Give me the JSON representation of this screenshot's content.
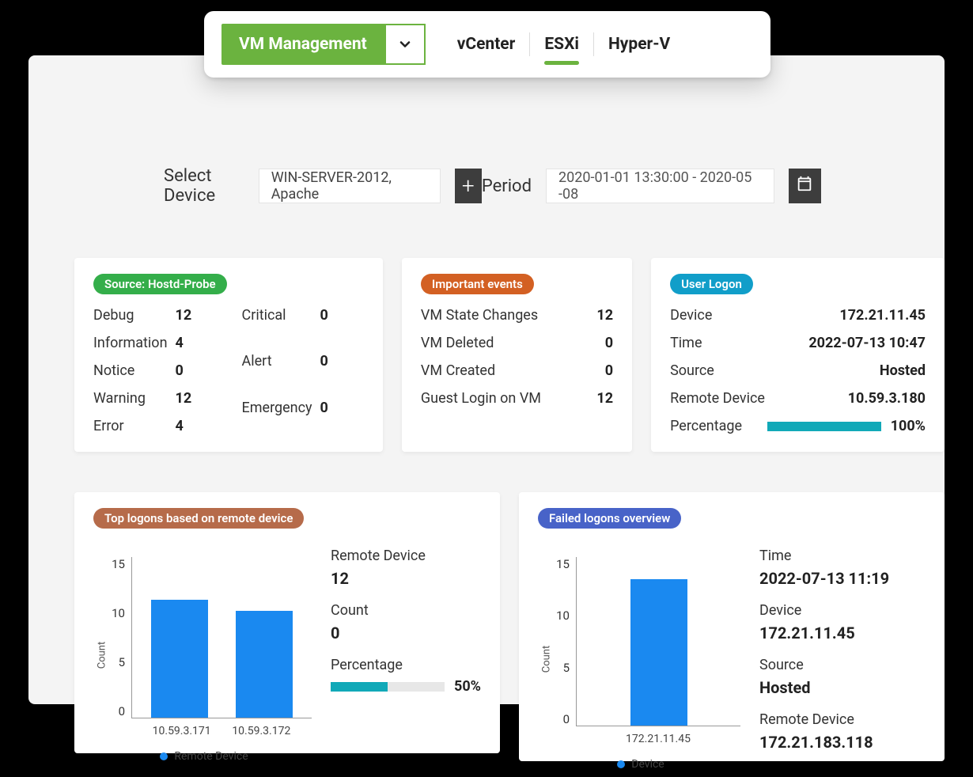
{
  "nav": {
    "dropdown_label": "VM Management",
    "tabs": [
      "vCenter",
      "ESXi",
      "Hyper-V"
    ],
    "active_tab": "ESXi"
  },
  "filters": {
    "device_label": "Select Device",
    "device_value": "WIN-SERVER-2012, Apache",
    "period_label": "Period",
    "period_value": "2020-01-01 13:30:00 - 2020-05 -08"
  },
  "card_source": {
    "title": "Source: Hostd-Probe",
    "left": [
      {
        "k": "Debug",
        "v": "12"
      },
      {
        "k": "Information",
        "v": "4"
      },
      {
        "k": "Notice",
        "v": "0"
      },
      {
        "k": "Warning",
        "v": "12"
      },
      {
        "k": "Error",
        "v": "4"
      }
    ],
    "right": [
      {
        "k": "Critical",
        "v": "0"
      },
      {
        "k": "Alert",
        "v": "0"
      },
      {
        "k": "Emergency",
        "v": "0"
      }
    ]
  },
  "card_events": {
    "title": "Important events",
    "rows": [
      {
        "k": "VM State Changes",
        "v": "12"
      },
      {
        "k": "VM Deleted",
        "v": "0"
      },
      {
        "k": "VM Created",
        "v": "0"
      },
      {
        "k": "Guest Login on VM",
        "v": "12"
      }
    ]
  },
  "card_logon": {
    "title": "User Logon",
    "rows": [
      {
        "k": "Device",
        "v": "172.21.11.45"
      },
      {
        "k": "Time",
        "v": "2022-07-13 10:47"
      },
      {
        "k": "Source",
        "v": "Hosted"
      },
      {
        "k": "Remote Device",
        "v": "10.59.3.180"
      }
    ],
    "percentage_label": "Percentage",
    "percentage_value": "100%",
    "percentage_pct": 100
  },
  "card_top_logons": {
    "title": "Top logons based on remote device",
    "side": {
      "remote_device_label": "Remote Device",
      "remote_device_value": "12",
      "count_label": "Count",
      "count_value": "0",
      "percentage_label": "Percentage",
      "percentage_value": "50%",
      "percentage_pct": 50
    }
  },
  "card_failed": {
    "title": "Failed logons overview",
    "side": [
      {
        "k": "Time",
        "v": "2022-07-13 11:19"
      },
      {
        "k": "Device",
        "v": "172.21.11.45"
      },
      {
        "k": "Source",
        "v": "Hosted"
      },
      {
        "k": "Remote Device",
        "v": "172.21.183.118"
      }
    ]
  },
  "chart_data": [
    {
      "id": "top_logons",
      "type": "bar",
      "categories": [
        "10.59.3.171",
        "10.59.3.172"
      ],
      "values": [
        11,
        10
      ],
      "ylabel": "Count",
      "ylim": [
        0,
        15
      ],
      "yticks": [
        0,
        5,
        10,
        15
      ],
      "legend": "Remote Device"
    },
    {
      "id": "failed_logons",
      "type": "bar",
      "categories": [
        "172.21.11.45"
      ],
      "values": [
        13
      ],
      "ylabel": "Count",
      "ylim": [
        0,
        15
      ],
      "yticks": [
        0,
        5,
        10,
        15
      ],
      "legend": "Device"
    }
  ]
}
